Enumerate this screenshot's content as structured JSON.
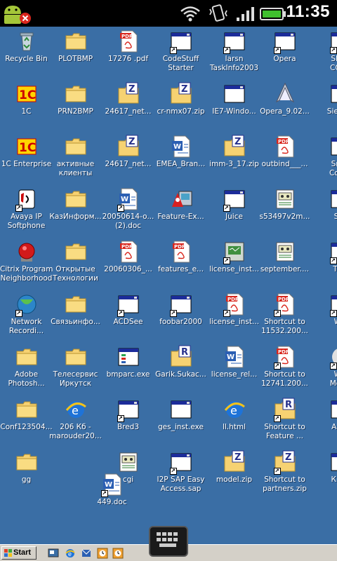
{
  "status_bar": {
    "time": "11:35"
  },
  "desktop": {
    "columns": [
      [
        "Recycle Bin",
        "1C",
        "1C Enterprise",
        "Avaya IP\nSoftphone",
        "Citrix Program\nNeighborhood",
        "Network\nRecordi...",
        "Adobe\nPhotosh...",
        "Conf123504...",
        "gg"
      ],
      [
        "PLOTBMP",
        "PRN2BMP",
        "активные\nклиенты",
        "КазИнформ...",
        "Открытые\nТехнологии",
        "Связьинфо...",
        "Телесервис\nИркутск",
        "206 Кб -\nmarouder20...",
        ""
      ],
      [
        "17276 .pdf",
        "24617_net...",
        "24617_net...",
        "20050614-o...\n(2).doc",
        "20060306_...",
        "ACDSee",
        "bmparc.exe",
        "Bred3",
        "cgi"
      ],
      [
        "CodeStuff\nStarter",
        "cr-nmx07.zip",
        "EMEA_Bran...",
        "Feature-Ex...",
        "features_e...",
        "foobar2000",
        "Garik.Sukac...",
        "ges_inst.exe",
        "I2P SAP Easy\nAccess.sap"
      ],
      [
        "Iarsn\nTaskInfo2003",
        "IE7-Windo...",
        "imm-3_17.zip",
        "Juice",
        "license_inst...",
        "license_inst...",
        "license_rel...",
        "ll.html",
        "model.zip"
      ],
      [
        "Opera",
        "Opera_9.02...",
        "outbind___...",
        "s53497v2m...",
        "september....",
        "Shortcut to\n11532.200...",
        "Shortcut to\n12741.200...",
        "Shortcut to\nFeature ...",
        "Shortcut to\npartners.zip"
      ],
      [
        "Short\nCOPM",
        "Siemen",
        "Smar\nConve",
        "Sop",
        "Turb",
        "Win",
        "Win\nMedia",
        "Анке",
        "Книп"
      ]
    ],
    "extra_icon": {
      "label": "449.doc"
    }
  },
  "taskbar": {
    "start_label": "Start"
  },
  "colors": {
    "desktop": "#3a6ea5",
    "taskbar": "#d4d0c8",
    "statusbar": "#000000"
  }
}
